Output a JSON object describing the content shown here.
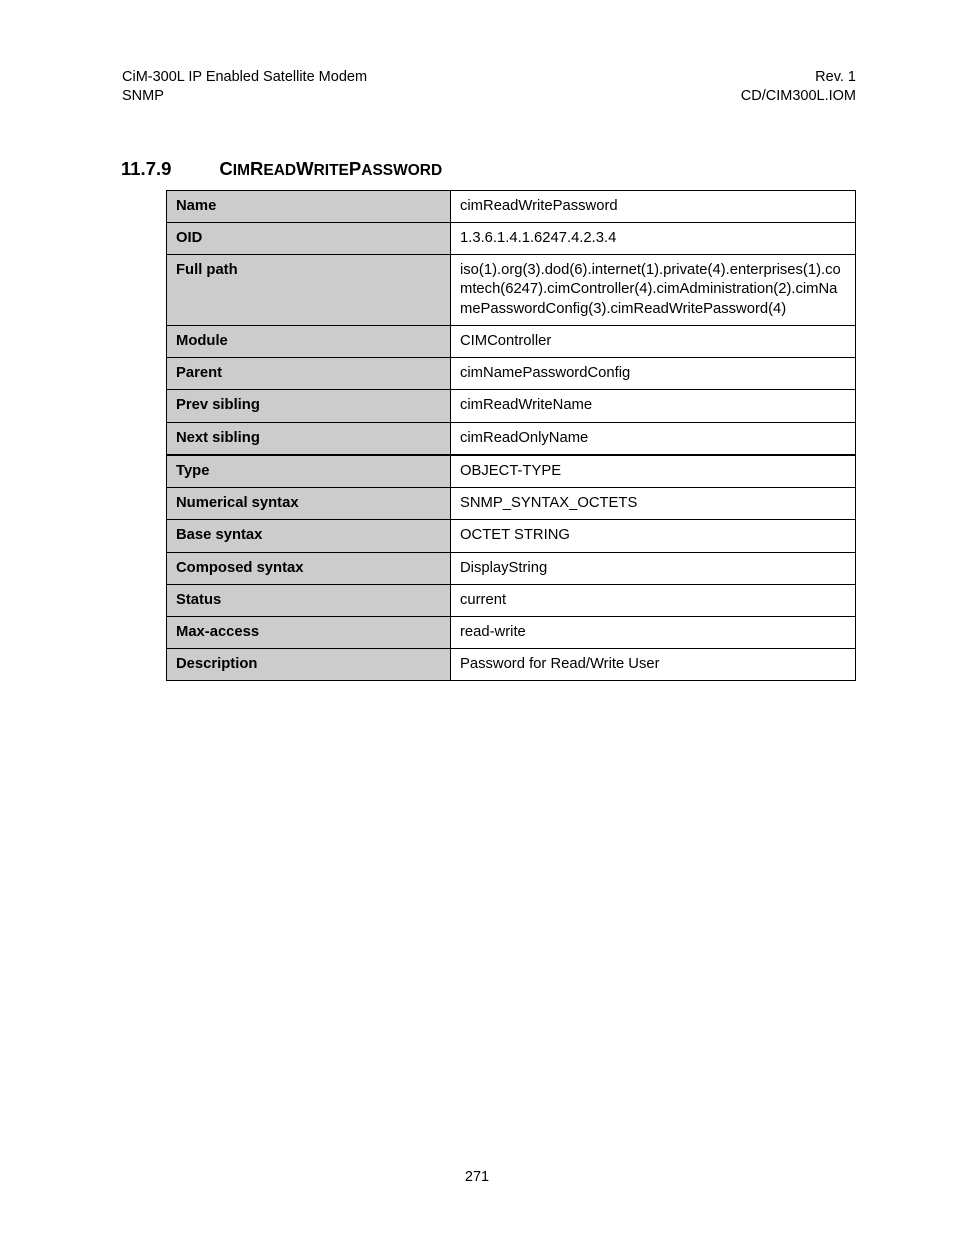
{
  "header": {
    "left_line1": "CiM-300L IP Enabled Satellite Modem",
    "left_line2": "SNMP",
    "right_line1": "Rev. 1",
    "right_line2": "CD/CIM300L.IOM"
  },
  "section": {
    "number": "11.7.9",
    "title_parts": [
      "C",
      "IM",
      "R",
      "EAD",
      "W",
      "RITE",
      "P",
      "ASSWORD"
    ]
  },
  "rows": [
    {
      "label": "Name",
      "value": "cimReadWritePassword"
    },
    {
      "label": "OID",
      "value": "1.3.6.1.4.1.6247.4.2.3.4"
    },
    {
      "label": "Full path",
      "value": "iso(1).org(3).dod(6).internet(1).private(4).enterprises(1).comtech(6247).cimController(4).cimAdministration(2).cimNamePasswordConfig(3).cimReadWritePassword(4)"
    },
    {
      "label": "Module",
      "value": "CIMController"
    },
    {
      "label": "Parent",
      "value": "cimNamePasswordConfig"
    },
    {
      "label": "Prev sibling",
      "value": "cimReadWriteName"
    },
    {
      "label": "Next sibling",
      "value": "cimReadOnlyName"
    },
    {
      "label": "Type",
      "value": "OBJECT-TYPE",
      "thickTop": true
    },
    {
      "label": "Numerical syntax",
      "value": "SNMP_SYNTAX_OCTETS"
    },
    {
      "label": "Base syntax",
      "value": "OCTET STRING"
    },
    {
      "label": "Composed syntax",
      "value": "DisplayString"
    },
    {
      "label": "Status",
      "value": "current"
    },
    {
      "label": "Max-access",
      "value": "read-write"
    },
    {
      "label": "Description",
      "value": "Password for Read/Write User"
    }
  ],
  "page_number": "271"
}
